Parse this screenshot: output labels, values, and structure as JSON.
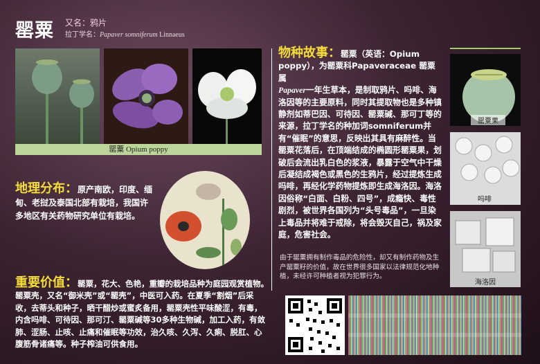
{
  "header": {
    "title": "罂粟",
    "alias": "又名：鸦片",
    "latin_prefix": "拉丁学名：",
    "latin_genus_species": "Papaver somniferum",
    "latin_author": "Linnaeus"
  },
  "photo_caption": "罂粟 Opium poppy",
  "distribution": {
    "heading": "地理分布：",
    "text": "原产南欧，印度、缅甸、老挝及泰国北部有栽培，我国许多地区有关药物研究单位有栽培。"
  },
  "value": {
    "heading": "重要价值：",
    "text": "罂粟，花大、色艳，重瓣的栽培品种为庭园观赏植物。罂粟壳，又名“御米壳”或“罂壳”，中医可入药。在夏季“割烟”后采收，去蒂头和种子，晒干醋炒或蜜炙备用，罂粟壳性平味酸涩，有毒，内含吗啡、可待因、那可汀、罂粟碱等30多种生物碱，加工入药，有敛肺、涩肠、止咳、止痛和催眠等功效，治久咳、久泻、久痢、脱肛、心腹筋骨诸痛等。种子榨油可供食用。"
  },
  "story": {
    "heading": "物种故事：",
    "text_part1": "罂粟（英语：Opium poppy），为罂粟科Papaveraceae 罂粟属",
    "genus_italic": "Papaver",
    "text_part2": "一年生草本，是制取鸦片、吗啡、海洛因等的主要原料，同时其提取物也是多种镇静剂如蒂巴因、可待因、罂粟碱、那可丁等的来源，拉丁学名的种加词somniferum并有“催眠”的意思，反映出其具有麻醉性。当罂粟花落后，在顶端结成的椭圆形罂粟果，划破后会流出乳白色的浆液，暴露于空气中干燥后凝结成褐色或黑色的生鸦片，经过提炼生成吗啡，再经化学药物提炼即生成海洛因。海洛因俗称“白面、白粉、四号”，成瘾快、毒性剧烈，被世界各国列为“头号毒品”，一旦染上毒品并将难于戒除，将会毁灭自己，祸及家庭，危害社会。"
  },
  "note": "由于罂粟拥有制作毒品的危险性，却又有制作药物及生产罂粟籽的价值，故在世界很多国家以法律规范化地种植，未经许可种植者视为犯罪行为。",
  "side_photos": [
    {
      "label": "罂粟果"
    },
    {
      "label": "吗啡"
    },
    {
      "label": "海洛因"
    }
  ],
  "colors": {
    "heading_yellow": "#f4dc3a",
    "caption_green": "#bcd59a",
    "accent_line": "#a8c86c",
    "background_dark": "#2a1620"
  }
}
